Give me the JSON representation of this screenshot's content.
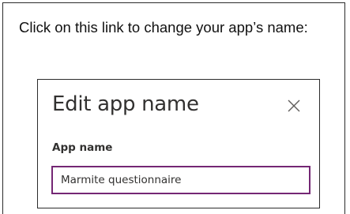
{
  "instruction": {
    "text": "Click on this link to change your app’s name:"
  },
  "dialog": {
    "title": "Edit app name",
    "close_icon": "close-icon",
    "field_label": "App name",
    "field_value": "Marmite questionnaire"
  },
  "colors": {
    "input_border": "#742774",
    "text": "#323130",
    "frame_border": "#2b2b2b"
  }
}
